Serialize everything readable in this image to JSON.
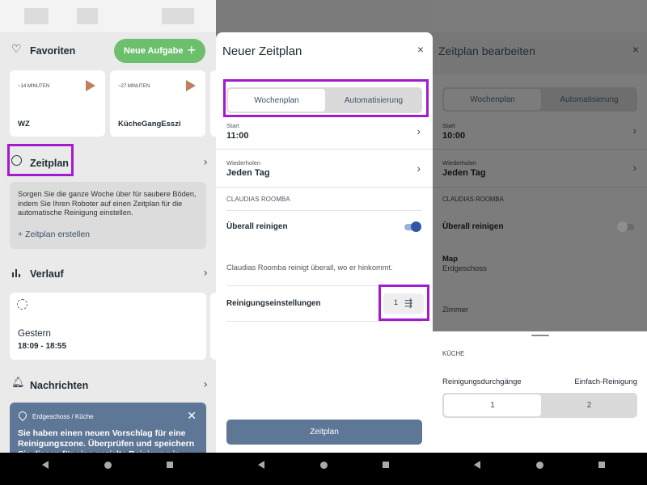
{
  "left": {
    "favorites": {
      "label": "Favoriten",
      "new_task": "Neue Aufgabe",
      "new_task_icon": "+"
    },
    "favorite_cards": [
      {
        "minutes": "~14 MINUTEN",
        "name": "WZ"
      },
      {
        "minutes": "~27 MINUTEN",
        "name": "KücheGangEsszi"
      }
    ],
    "schedule": {
      "label": "Zeitplan",
      "description": "Sorgen Sie die ganze Woche über für saubere Böden, indem Sie Ihren Roboter auf einen Zeitplan für die automatische Reinigung einstellen.",
      "create_link": "+ Zeitplan erstellen"
    },
    "history": {
      "label": "Verlauf",
      "day": "Gestern",
      "time": "18:09 - 18:55"
    },
    "messages": {
      "label": "Nachrichten",
      "notif_location": "Erdgeschoss / Küche",
      "notif_text": "Sie haben einen neuen Vorschlag für eine Reinigungszone. Überprüfen und speichern Sie diesen für eine gezielte Reinigung in dem"
    }
  },
  "middle": {
    "title": "Neuer Zeitplan",
    "close": "×",
    "tabs": [
      "Wochenplan",
      "Automatisierung"
    ],
    "start_label": "Start",
    "start_value": "11:00",
    "repeat_label": "Wiederholen",
    "repeat_value": "Jeden Tag",
    "section": "CLAUDIAS ROOMBA",
    "clean_everywhere": "Überall reinigen",
    "clean_everywhere_on": true,
    "description": "Claudias Roomba reinigt überall, wo er hinkommt.",
    "cleaning_settings": "Reinigungseinstellungen",
    "passes": "1",
    "submit": "Zeitplan"
  },
  "right": {
    "title": "Zeitplan bearbeiten",
    "close": "×",
    "tabs": [
      "Wochenplan",
      "Automatisierung"
    ],
    "start_label": "Start",
    "start_value": "10:00",
    "repeat_label": "Wiederholen",
    "repeat_value": "Jeden Tag",
    "section": "CLAUDIAS ROOMBA",
    "clean_everywhere": "Überall reinigen",
    "clean_everywhere_on": false,
    "map_label": "Map",
    "map_value": "Erdgeschoss",
    "rooms_label": "Zimmer",
    "sheet_section": "KÜCHE",
    "passes_label": "Reinigungsdurchgänge",
    "passes_value": "Einfach-Reinigung",
    "pass_options": [
      "1",
      "2"
    ]
  },
  "colors": {
    "accent_green": "#6cbf6c",
    "highlight_purple": "#a21bd1",
    "primary_button": "#5f7796",
    "toggle_on": "#2f56a8"
  }
}
